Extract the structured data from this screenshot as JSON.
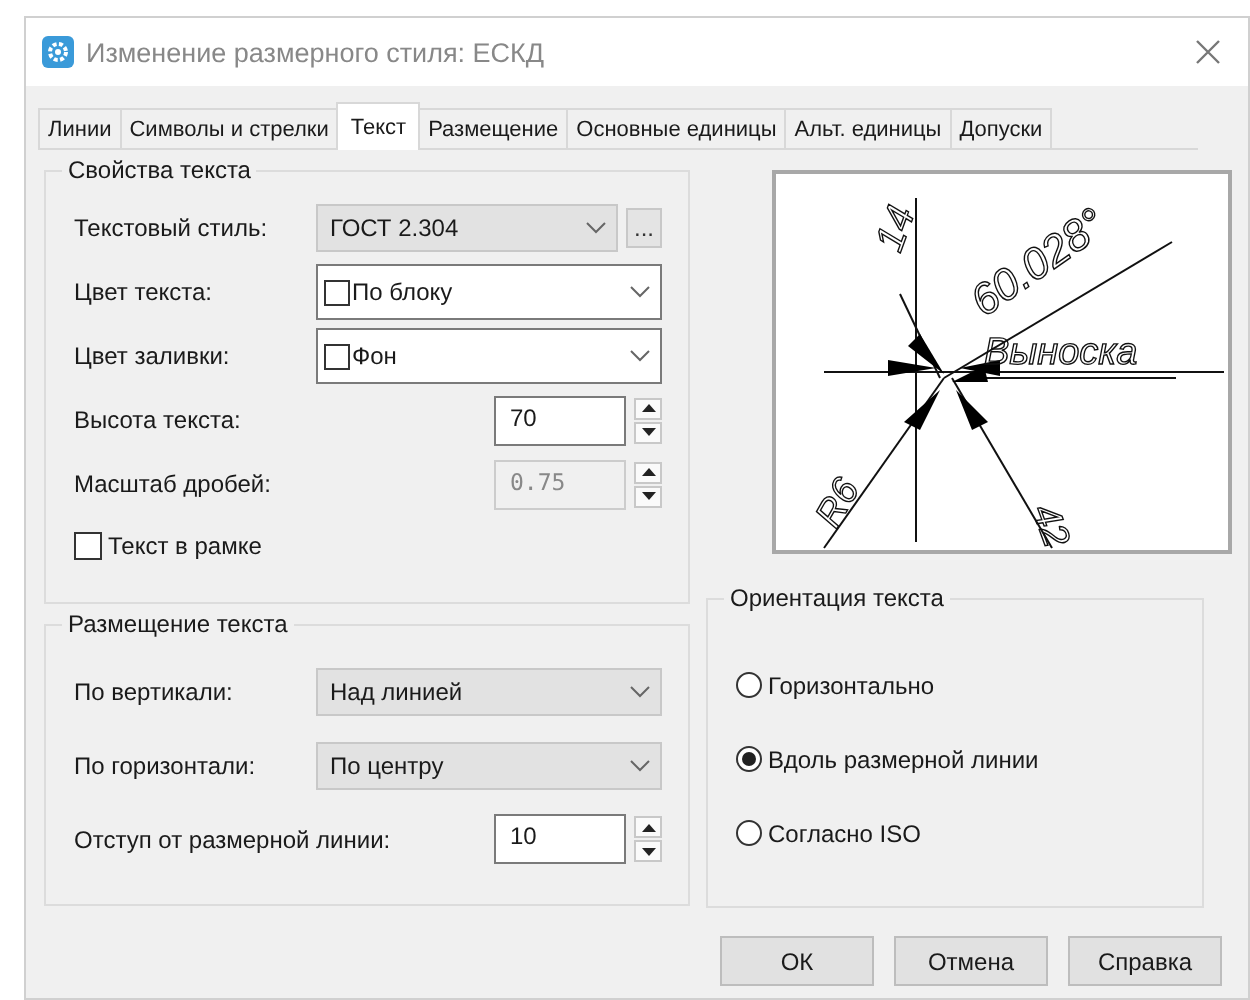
{
  "window": {
    "title": "Изменение размерного стиля: ЕСКД"
  },
  "tabs": [
    {
      "label": "Линии",
      "selected": false
    },
    {
      "label": "Символы и стрелки",
      "selected": false
    },
    {
      "label": "Текст",
      "selected": true
    },
    {
      "label": "Размещение",
      "selected": false
    },
    {
      "label": "Основные единицы",
      "selected": false
    },
    {
      "label": "Альт. единицы",
      "selected": false
    },
    {
      "label": "Допуски",
      "selected": false
    }
  ],
  "text_properties": {
    "title": "Свойства текста",
    "fields": [
      {
        "kind": "combo",
        "label": "Текстовый стиль:",
        "value": "ГОСТ 2.304",
        "button": "..."
      },
      {
        "kind": "color",
        "label": "Цвет текста:",
        "value": "По блоку"
      },
      {
        "kind": "color",
        "label": "Цвет заливки:",
        "value": "Фон"
      },
      {
        "kind": "spin",
        "label": "Высота текста:",
        "value": "70",
        "disabled": false
      },
      {
        "kind": "spin",
        "label": "Масштаб дробей:",
        "value": "0.75",
        "disabled": true
      },
      {
        "kind": "checkbox",
        "label": "Текст в рамке",
        "checked": false
      }
    ]
  },
  "text_placement": {
    "title": "Размещение текста",
    "fields": [
      {
        "kind": "combo",
        "label": "По вертикали:",
        "value": "Над линией"
      },
      {
        "kind": "combo",
        "label": "По горизонтали:",
        "value": "По центру"
      },
      {
        "kind": "spin",
        "label": "Отступ от размерной линии:",
        "value": "10",
        "disabled": false
      }
    ]
  },
  "preview": {
    "labels": [
      "14",
      "60.028°",
      "Выноска",
      "R6",
      "42"
    ]
  },
  "text_orientation": {
    "title": "Ориентация текста",
    "options": [
      {
        "label": "Горизонтально",
        "selected": false
      },
      {
        "label": "Вдоль размерной линии",
        "selected": true
      },
      {
        "label": "Согласно ISO",
        "selected": false
      }
    ]
  },
  "buttons": [
    "ОК",
    "Отмена",
    "Справка"
  ]
}
